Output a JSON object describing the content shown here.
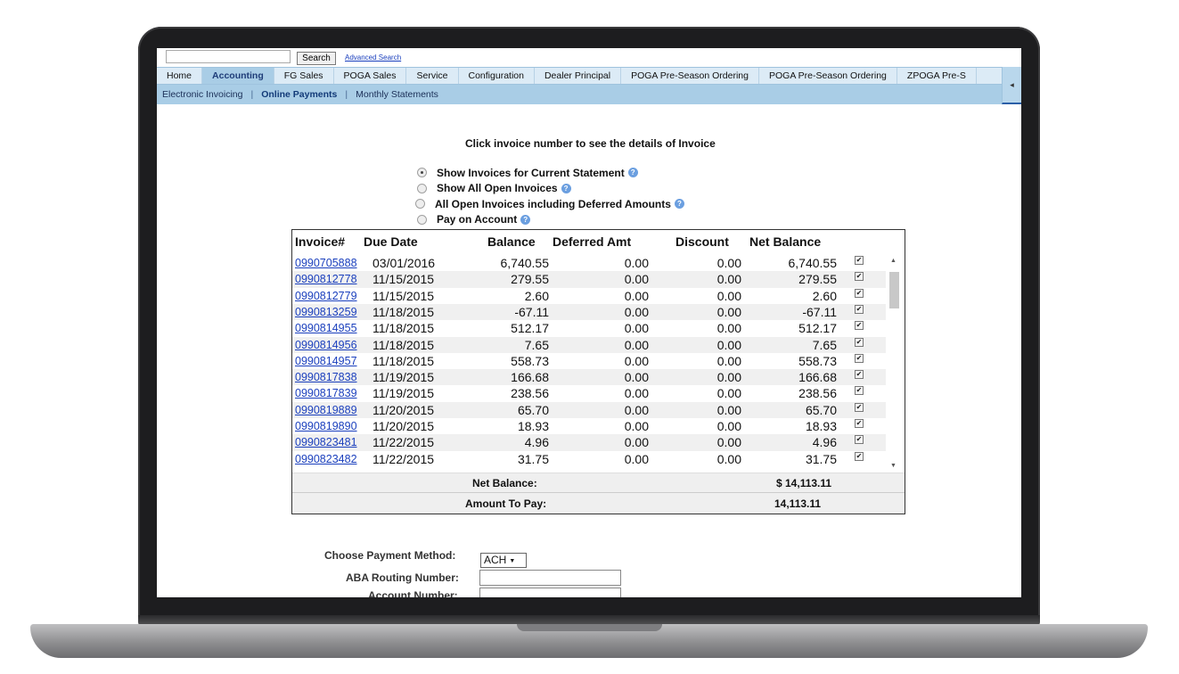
{
  "topbar": {
    "search_value": "",
    "search_button": "Search",
    "advanced_search": "Advanced Search"
  },
  "nav": {
    "tabs": [
      "Home",
      "Accounting",
      "FG Sales",
      "POGA Sales",
      "Service",
      "Configuration",
      "Dealer Principal",
      "POGA Pre-Season Ordering",
      "POGA Pre-Season Ordering",
      "ZPOGA Pre-S"
    ],
    "active_tab": "Accounting",
    "scroll_arrow": "◂"
  },
  "subnav": {
    "items": [
      "Electronic Invoicing",
      "Online Payments",
      "Monthly Statements"
    ],
    "separator": "|",
    "active": "Online Payments"
  },
  "instruction": "Click invoice number to see the details of Invoice",
  "radio_options": [
    {
      "label": "Show Invoices for Current Statement",
      "selected": true
    },
    {
      "label": "Show All Open Invoices",
      "selected": false
    },
    {
      "label": "All Open Invoices including Deferred Amounts",
      "selected": false
    },
    {
      "label": "Pay on Account",
      "selected": false
    }
  ],
  "help_glyph": "?",
  "table": {
    "headers": {
      "invoice": "Invoice#",
      "due_date": "Due Date",
      "balance": "Balance",
      "deferred": "Deferred Amt",
      "discount": "Discount",
      "net_balance": "Net Balance"
    },
    "check_glyph": "✔",
    "rows": [
      {
        "invoice": "0990705888",
        "due": "03/01/2016",
        "balance": "6,740.55",
        "deferred": "0.00",
        "discount": "0.00",
        "net": "6,740.55",
        "checked": true
      },
      {
        "invoice": "0990812778",
        "due": "11/15/2015",
        "balance": "279.55",
        "deferred": "0.00",
        "discount": "0.00",
        "net": "279.55",
        "checked": true
      },
      {
        "invoice": "0990812779",
        "due": "11/15/2015",
        "balance": "2.60",
        "deferred": "0.00",
        "discount": "0.00",
        "net": "2.60",
        "checked": true
      },
      {
        "invoice": "0990813259",
        "due": "11/18/2015",
        "balance": "-67.11",
        "deferred": "0.00",
        "discount": "0.00",
        "net": "-67.11",
        "checked": true
      },
      {
        "invoice": "0990814955",
        "due": "11/18/2015",
        "balance": "512.17",
        "deferred": "0.00",
        "discount": "0.00",
        "net": "512.17",
        "checked": true
      },
      {
        "invoice": "0990814956",
        "due": "11/18/2015",
        "balance": "7.65",
        "deferred": "0.00",
        "discount": "0.00",
        "net": "7.65",
        "checked": true
      },
      {
        "invoice": "0990814957",
        "due": "11/18/2015",
        "balance": "558.73",
        "deferred": "0.00",
        "discount": "0.00",
        "net": "558.73",
        "checked": true
      },
      {
        "invoice": "0990817838",
        "due": "11/19/2015",
        "balance": "166.68",
        "deferred": "0.00",
        "discount": "0.00",
        "net": "166.68",
        "checked": true
      },
      {
        "invoice": "0990817839",
        "due": "11/19/2015",
        "balance": "238.56",
        "deferred": "0.00",
        "discount": "0.00",
        "net": "238.56",
        "checked": true
      },
      {
        "invoice": "0990819889",
        "due": "11/20/2015",
        "balance": "65.70",
        "deferred": "0.00",
        "discount": "0.00",
        "net": "65.70",
        "checked": true
      },
      {
        "invoice": "0990819890",
        "due": "11/20/2015",
        "balance": "18.93",
        "deferred": "0.00",
        "discount": "0.00",
        "net": "18.93",
        "checked": true
      },
      {
        "invoice": "0990823481",
        "due": "11/22/2015",
        "balance": "4.96",
        "deferred": "0.00",
        "discount": "0.00",
        "net": "4.96",
        "checked": true
      },
      {
        "invoice": "0990823482",
        "due": "11/22/2015",
        "balance": "31.75",
        "deferred": "0.00",
        "discount": "0.00",
        "net": "31.75",
        "checked": true
      }
    ],
    "scroll_up": "▲",
    "scroll_down": "▼"
  },
  "totals": {
    "net_balance_label": "Net Balance:",
    "net_balance_value": "$ 14,113.11",
    "amount_to_pay_label": "Amount To Pay:",
    "amount_to_pay_value": "14,113.11"
  },
  "payment": {
    "method_label": "Choose Payment Method:",
    "method_value": "ACH",
    "caret": "▼",
    "routing_label": "ABA Routing Number:",
    "routing_value": "",
    "account_label": "Account Number:",
    "account_value": ""
  }
}
